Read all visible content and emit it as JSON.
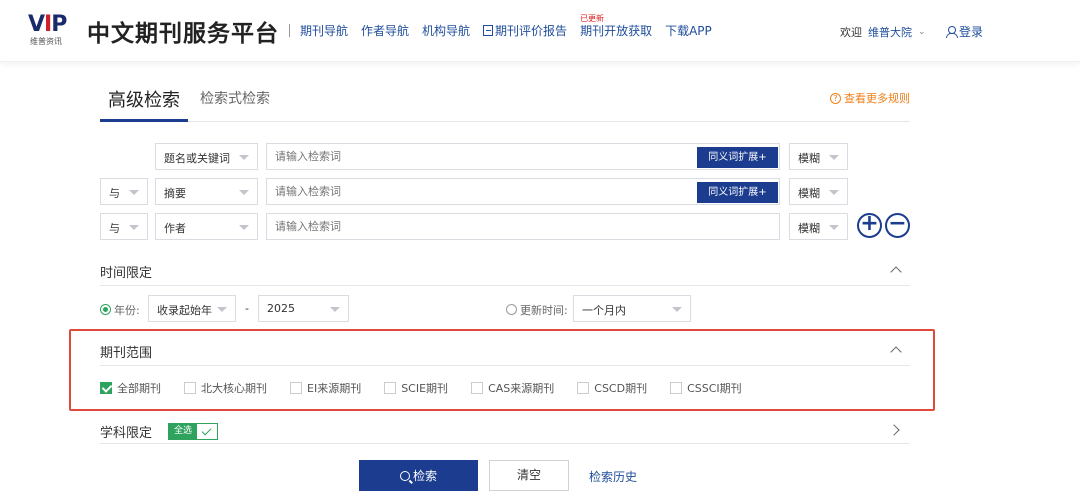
{
  "header": {
    "logo_text": "VIP",
    "logo_sub": "维普资讯",
    "site_title": "中文期刊服务平台",
    "nav": [
      {
        "label": "期刊导航"
      },
      {
        "label": "作者导航"
      },
      {
        "label": "机构导航"
      },
      {
        "label": "期刊评价报告",
        "icon": "document-icon"
      },
      {
        "label": "期刊开放获取",
        "badge": "已更新"
      },
      {
        "label": "下载APP"
      }
    ],
    "welcome": "欢迎",
    "org_name": "维普大院",
    "login": "登录"
  },
  "tabs": {
    "active": "高级检索",
    "other": "检索式检索",
    "more_rules": "查看更多规则"
  },
  "search_rows": [
    {
      "logic": "",
      "field": "题名或关键词",
      "placeholder": "请输入检索词",
      "synonym": "同义词扩展+",
      "match": "模糊"
    },
    {
      "logic": "与",
      "field": "摘要",
      "placeholder": "请输入检索词",
      "synonym": "同义词扩展+",
      "match": "模糊"
    },
    {
      "logic": "与",
      "field": "作者",
      "placeholder": "请输入检索词",
      "synonym": "",
      "match": "模糊"
    }
  ],
  "time_limit": {
    "title": "时间限定",
    "year_label": "年份:",
    "year_from": "收录起始年",
    "dash": "-",
    "year_to": "2025",
    "update_label": "更新时间:",
    "update_value": "一个月内",
    "selected": "year"
  },
  "journal_scope": {
    "title": "期刊范围",
    "options": [
      {
        "label": "全部期刊",
        "checked": true
      },
      {
        "label": "北大核心期刊",
        "checked": false
      },
      {
        "label": "EI来源期刊",
        "checked": false
      },
      {
        "label": "SCIE期刊",
        "checked": false
      },
      {
        "label": "CAS来源期刊",
        "checked": false
      },
      {
        "label": "CSCD期刊",
        "checked": false
      },
      {
        "label": "CSSCI期刊",
        "checked": false
      }
    ]
  },
  "subject_limit": {
    "title": "学科限定",
    "select_all": "全选"
  },
  "actions": {
    "search": "检索",
    "clear": "清空",
    "history": "检索历史"
  },
  "colors": {
    "primary": "#1b3c8f",
    "link": "#1f4d9a",
    "green": "#2fa35e",
    "orange": "#f0801c",
    "highlight": "#e04a3a"
  }
}
